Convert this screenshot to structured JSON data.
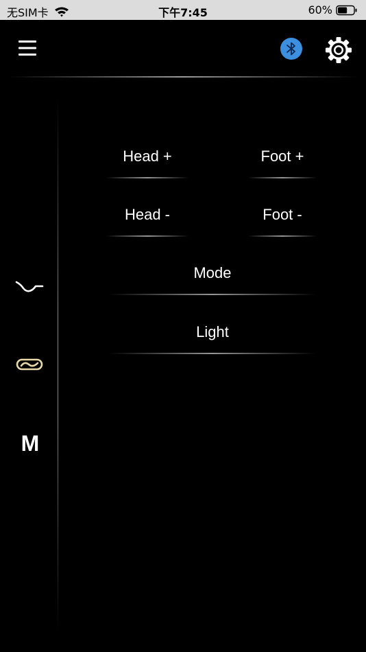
{
  "status_bar": {
    "carrier": "无SIM卡",
    "time": "下午7:45",
    "battery": "60%",
    "battery_level": 0.6
  },
  "header": {
    "menu_icon": "menu-icon",
    "bluetooth_icon": "bluetooth-icon",
    "settings_icon": "gear-icon",
    "bluetooth_color": "#3d8fe0"
  },
  "sidebar": {
    "items": [
      {
        "icon": "curve-icon"
      },
      {
        "icon": "loop-icon",
        "color": "#e8d9a8"
      },
      {
        "icon": "m-icon",
        "label": "M"
      }
    ]
  },
  "controls": {
    "head_plus": "Head +",
    "foot_plus": "Foot +",
    "head_minus": "Head -",
    "foot_minus": "Foot -",
    "mode": "Mode",
    "light": "Light"
  }
}
